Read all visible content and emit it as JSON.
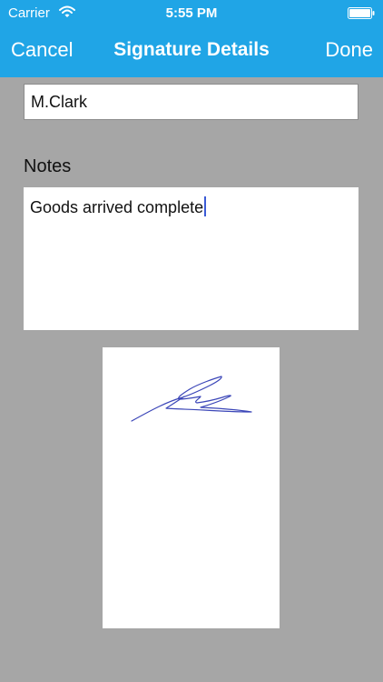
{
  "status_bar": {
    "carrier": "Carrier",
    "time": "5:55 PM",
    "icons": [
      "wifi-icon",
      "battery-icon"
    ]
  },
  "nav": {
    "cancel_label": "Cancel",
    "title": "Signature Details",
    "done_label": "Done"
  },
  "form": {
    "name_value": "M.Clark",
    "notes_label": "Notes",
    "notes_value": "Goods arrived complete"
  },
  "colors": {
    "header": "#20a5e6",
    "background": "#a6a6a6",
    "signature_ink": "#3b46b8",
    "caret": "#3b5bd6"
  }
}
